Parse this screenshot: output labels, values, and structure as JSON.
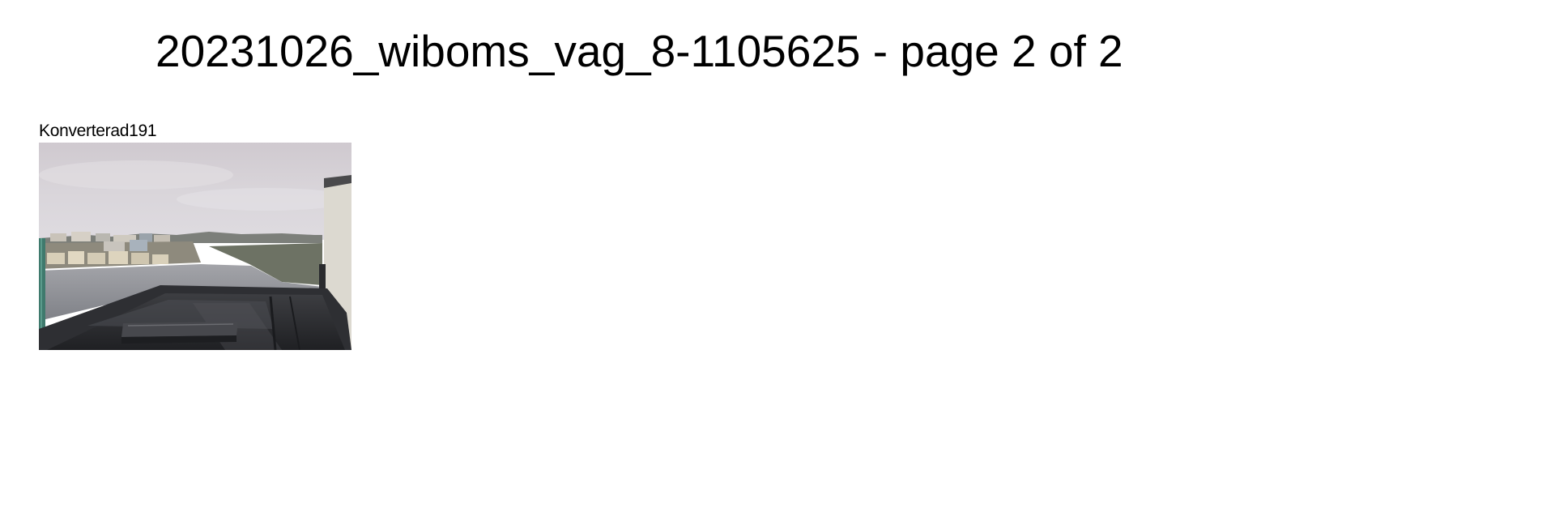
{
  "document": {
    "title": "20231026_wiboms_vag_8-1105625 - page 2 of 2"
  },
  "photos": [
    {
      "caption": "Konverterad191",
      "scene": "rooftop-waterfront-view-photo"
    }
  ],
  "colors": {
    "background": "#ffffff",
    "text": "#000000",
    "sky": "#d6d2d7",
    "water": "#8d8f94",
    "roof": "#2c2d30",
    "wall": "#dcd9d0"
  }
}
